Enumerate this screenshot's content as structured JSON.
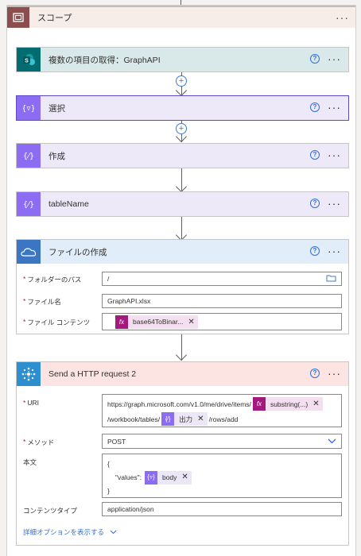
{
  "scope": {
    "title": "スコープ",
    "more": "···"
  },
  "actions": [
    {
      "title": "複数の項目の取得：GraphAPI",
      "help": "?",
      "more": "···"
    },
    {
      "title": "選択",
      "help": "?",
      "more": "···"
    },
    {
      "title": "作成",
      "help": "?",
      "more": "···"
    },
    {
      "title": "tableName",
      "help": "?",
      "more": "···"
    },
    {
      "title": "ファイルの作成",
      "help": "?",
      "more": "···"
    },
    {
      "title": "Send a HTTP request 2",
      "help": "?",
      "more": "···"
    }
  ],
  "create_file": {
    "folder_label": "フォルダーのパス",
    "folder_value": "/",
    "filename_label": "ファイル名",
    "filename_value": "GraphAPI.xlsx",
    "content_label": "ファイル コンテンツ",
    "content_token": "base64ToBinar..."
  },
  "http": {
    "uri_label": "URI",
    "uri_part1": "https://graph.microsoft.com/v1.0/me/drive/items/",
    "uri_token1": "substring(...)",
    "uri_part2": "/workbook/tables/",
    "uri_token2": "出力",
    "uri_part3": "/rows/add",
    "method_label": "メソッド",
    "method_value": "POST",
    "body_label": "本文",
    "body_open": "{",
    "body_key": "\"values\":",
    "body_token": "body",
    "body_close": "}",
    "content_type_label": "コンテンツタイプ",
    "content_type_value": "application/json",
    "advanced_link": "詳細オプションを表示する"
  },
  "colors": {
    "scope_header": "#f6ece8",
    "scope_icon": "#8b4d4d",
    "sharepoint_header": "#d9e8e8",
    "sharepoint_icon": "#036c70",
    "data_op_header": "#ede9f9",
    "data_op_icon": "#8c6cf2",
    "onedrive_header": "#e1edf8",
    "onedrive_icon": "#3b76c4",
    "http_header": "#fbe4e1",
    "http_icon": "#2d8fcf",
    "expression_token": "#a5197f"
  }
}
